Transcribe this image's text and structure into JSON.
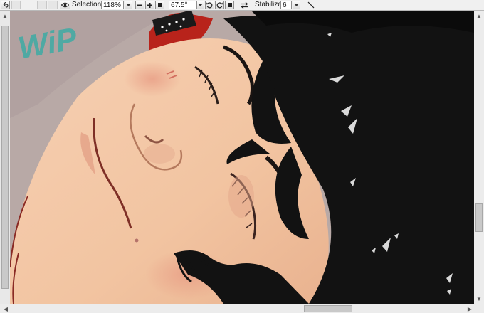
{
  "toolbar": {
    "selection_label": "Selection",
    "zoom_value": "118%",
    "rotation_value": "67.5°",
    "stabilizer_label": "Stabilizer",
    "stabilizer_value": "6"
  },
  "canvas": {
    "annotation_text": "WiP"
  },
  "colors": {
    "annotation": "#4fa9a3",
    "hair": "#121212",
    "skin": "#f4c9a8",
    "background": "#b8a9a6"
  }
}
